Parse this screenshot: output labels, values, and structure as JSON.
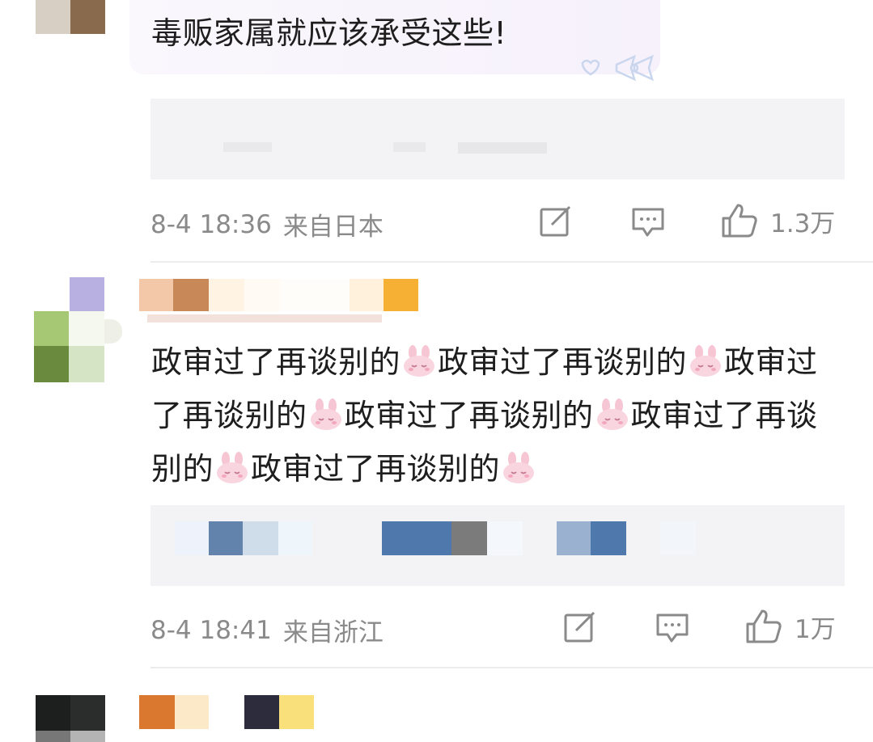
{
  "comments": [
    {
      "text": "毒贩家属就应该承受这些!",
      "time": "8-4 18:36",
      "location": "来自日本",
      "likes": "1.3万"
    },
    {
      "text_segments": [
        "政审过了再谈别的",
        "政审过了再谈别的",
        "政审过了再谈别的",
        "政审过了再谈别的",
        "政审过了再谈别的",
        "政审过了再谈别的"
      ],
      "time": "8-4 18:41",
      "location": "来自浙江",
      "likes": "1万"
    }
  ],
  "icons": {
    "share": "share-edit-icon",
    "comment": "comment-bubble-icon",
    "like": "thumbs-up-icon",
    "emoji": "bunny-emoji-icon",
    "bubble_decoration": "bow-heart-icon"
  },
  "colors": {
    "text": "#1e1e1e",
    "meta": "#8a8a8a",
    "reply_bg": "#f3f3f5",
    "divider": "#ececec"
  }
}
